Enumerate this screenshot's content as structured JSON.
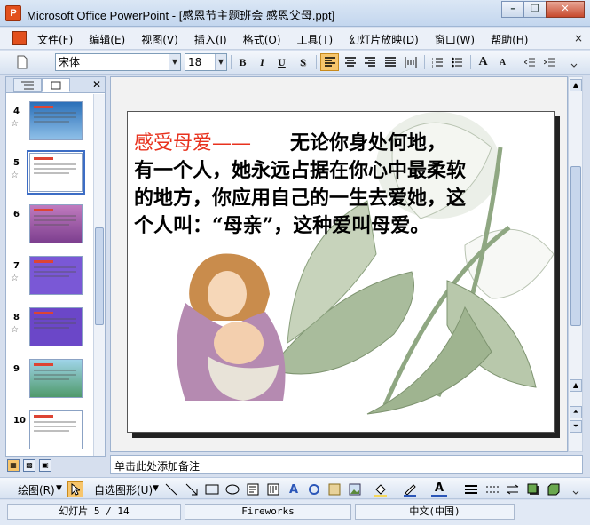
{
  "window": {
    "title": "Microsoft Office PowerPoint - [感恩节主题班会 感恩父母.ppt]",
    "app_icon": "P"
  },
  "menu": {
    "items": [
      "文件(F)",
      "编辑(E)",
      "视图(V)",
      "插入(I)",
      "格式(O)",
      "工具(T)",
      "幻灯片放映(D)",
      "窗口(W)",
      "帮助(H)"
    ],
    "right_glyph": "×"
  },
  "toolbar": {
    "font_name": "宋体",
    "font_size": "18",
    "bold": "B",
    "italic": "I",
    "underline": "U",
    "shadow": "S",
    "grow": "A",
    "shrink": "A"
  },
  "slides_pane": {
    "thumbnails": [
      {
        "num": "4",
        "starred": true
      },
      {
        "num": "5",
        "starred": true,
        "selected": true
      },
      {
        "num": "6",
        "starred": false
      },
      {
        "num": "7",
        "starred": true
      },
      {
        "num": "8",
        "starred": true
      },
      {
        "num": "9",
        "starred": false
      },
      {
        "num": "10",
        "starred": false
      }
    ]
  },
  "slide": {
    "heading": "感受母爱——",
    "body_lines": [
      "　　无论你身处何地，",
      "有一个人，她永远占据在你心中最柔软",
      "的地方，你应用自己的一生去爱她，这",
      "个人叫：“母亲”，这种爱叫母爱。"
    ]
  },
  "notes": {
    "placeholder": "单击此处添加备注"
  },
  "drawing_toolbar": {
    "draw_label": "绘图(R)",
    "autoshapes_label": "自选图形(U)"
  },
  "status": {
    "slide_counter": "幻灯片 5 / 14",
    "template": "Fireworks",
    "language": "中文(中国)"
  },
  "colors": {
    "heading_red": "#e8321e",
    "accent": "#3d6dc5"
  }
}
